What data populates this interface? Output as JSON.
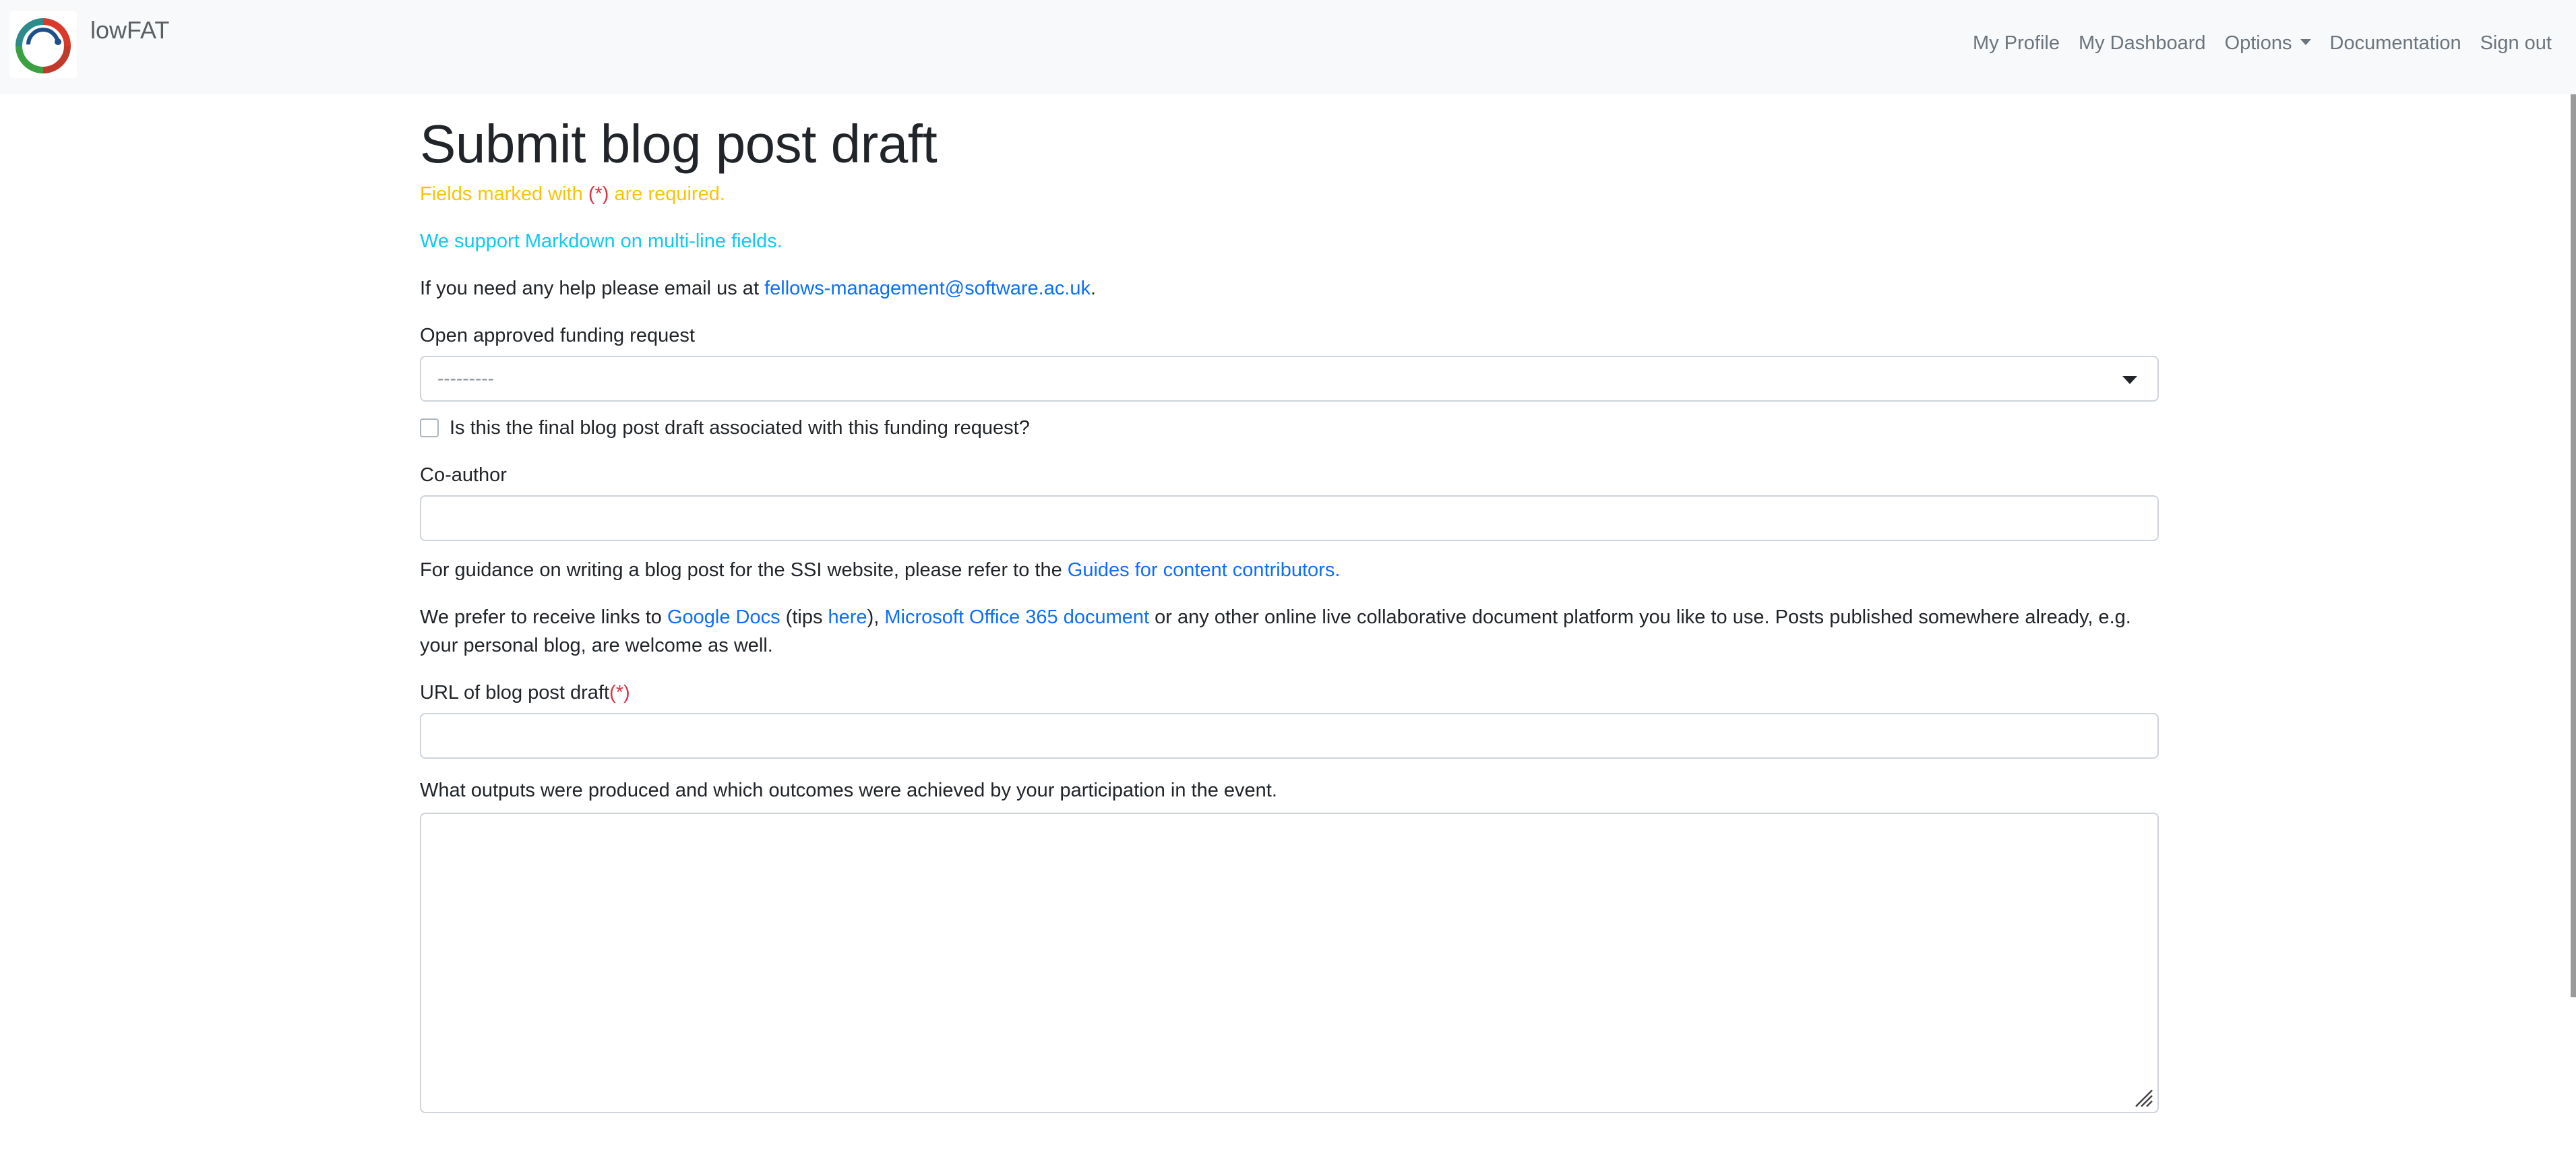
{
  "navbar": {
    "brand": "lowFAT",
    "links": {
      "my_profile": "My Profile",
      "my_dashboard": "My Dashboard",
      "options": "Options",
      "documentation": "Documentation",
      "sign_out": "Sign out"
    }
  },
  "page": {
    "title": "Submit blog post draft",
    "required_note": {
      "prefix": "Fields marked with ",
      "marker": "(*)",
      "suffix": " are required."
    },
    "markdown_note": "We support Markdown on multi-line fields.",
    "help": {
      "prefix": "If you need any help please email us at ",
      "email": "fellows-management@software.ac.uk",
      "suffix": "."
    }
  },
  "form": {
    "funding_request": {
      "label": "Open approved funding request",
      "selected": "---------"
    },
    "final_checkbox": {
      "label": "Is this the final blog post draft associated with this funding request?",
      "checked": false
    },
    "coauthor": {
      "label": "Co-author",
      "value": ""
    },
    "guidance": {
      "prefix": "For guidance on writing a blog post for the SSI website, please refer to the ",
      "link": "Guides for content contributors."
    },
    "prefer": {
      "prefix": "We prefer to receive links to ",
      "google_docs": "Google Docs",
      "tips_open": " (tips ",
      "tips_link": "here",
      "tips_close": "), ",
      "office_link": "Microsoft Office 365 document",
      "suffix": " or any other online live collaborative document platform you like to use. Posts published somewhere already, e.g. your personal blog, are welcome as well."
    },
    "url": {
      "label": "URL of blog post draft",
      "marker": "(*)",
      "value": ""
    },
    "outputs": {
      "label": "What outputs were produced and which outcomes were achieved by your participation in the event.",
      "value": ""
    }
  },
  "colors": {
    "required_marker": "#dc3545",
    "warning_text": "#ffc107",
    "info_text": "#0dcaf0",
    "link": "#0d6efd"
  }
}
